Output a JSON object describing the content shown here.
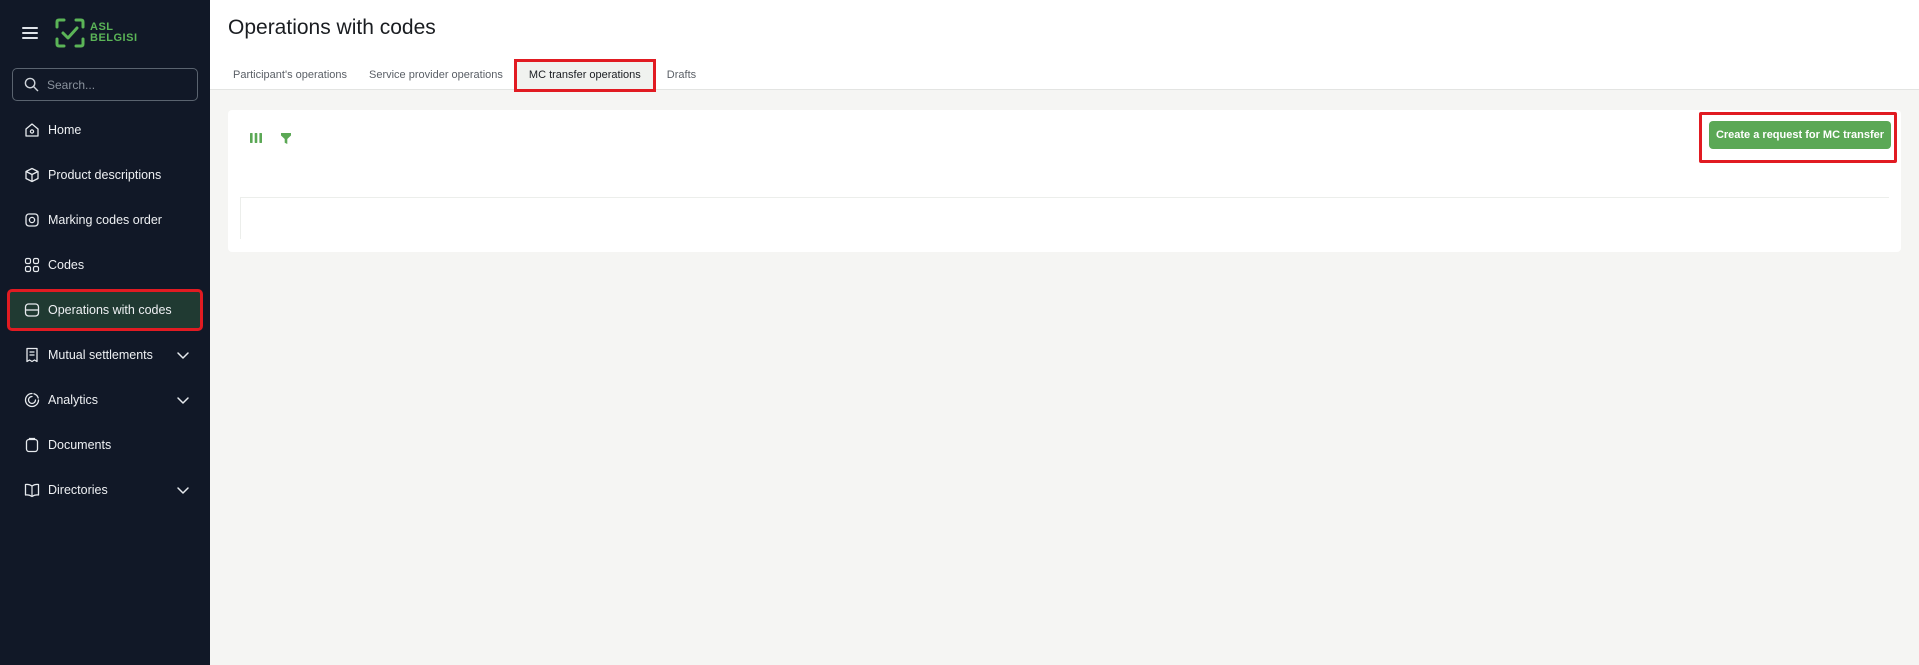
{
  "app": {
    "logo_text_line1": "ASL",
    "logo_text_line2": "BELGISI",
    "brand_color": "#5ba855",
    "highlight_color": "#e11b22"
  },
  "sidebar": {
    "search_placeholder": "Search...",
    "items": [
      {
        "label": "Home",
        "icon": "home-icon"
      },
      {
        "label": "Product descriptions",
        "icon": "box-icon"
      },
      {
        "label": "Marking codes order",
        "icon": "order-icon"
      },
      {
        "label": "Codes",
        "icon": "codes-icon"
      },
      {
        "label": "Operations with codes",
        "icon": "operations-icon",
        "active": true
      },
      {
        "label": "Mutual settlements",
        "icon": "receipt-icon",
        "expandable": true
      },
      {
        "label": "Analytics",
        "icon": "analytics-icon",
        "expandable": true
      },
      {
        "label": "Documents",
        "icon": "clipboard-icon"
      },
      {
        "label": "Directories",
        "icon": "book-icon",
        "expandable": true
      }
    ]
  },
  "main": {
    "title": "Operations with codes",
    "tabs": [
      {
        "label": "Participant's operations"
      },
      {
        "label": "Service provider operations"
      },
      {
        "label": "MC transfer operations",
        "active": true
      },
      {
        "label": "Drafts"
      }
    ],
    "toolbar": {
      "columns_icon": "columns-icon",
      "filter_icon": "filter-icon",
      "create_label": "Create a request for MC transfer"
    }
  }
}
